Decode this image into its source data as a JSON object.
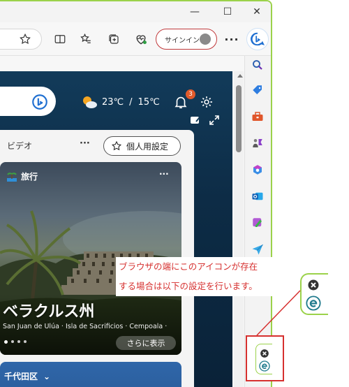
{
  "window": {
    "minimize_glyph": "—",
    "maximize_glyph": "☐",
    "close_glyph": "✕"
  },
  "toolbar": {
    "signin_label": "サインイン",
    "more_glyph": "···",
    "icons": [
      "star-icon",
      "split-screen-icon",
      "favorites-icon",
      "collections-icon",
      "browser-essentials-icon",
      "bing-copilot-icon"
    ]
  },
  "header": {
    "temp_high": "23℃",
    "separator": "/",
    "temp_low": "15℃",
    "notification_count": "3"
  },
  "feed": {
    "tab_label": "ビデオ",
    "more_glyph": "···",
    "personal_button_label": "個人用設定",
    "card": {
      "category": "旅行",
      "more_glyph": "···",
      "title": "ベラクルス州",
      "subtitle": "San Juan de Ulúa · Isla de Sacrificios · Cempoala ·",
      "more_button_label": "さらに表示"
    },
    "card2": {
      "title": "千代田区",
      "chevron": "⌄"
    }
  },
  "sidebar": {
    "icons": [
      "search-icon",
      "shopping-tag-icon",
      "tools-icon",
      "games-icon",
      "microsoft365-icon",
      "outlook-icon",
      "designer-icon",
      "send-icon"
    ]
  },
  "annotation": {
    "line1": "ブラウザの端にこのアイコンが存在",
    "line2": "する場合は以下の設定を行います。",
    "colors": {
      "text": "#d6302f",
      "border": "#9bd24a",
      "box": "#d6302f"
    }
  }
}
